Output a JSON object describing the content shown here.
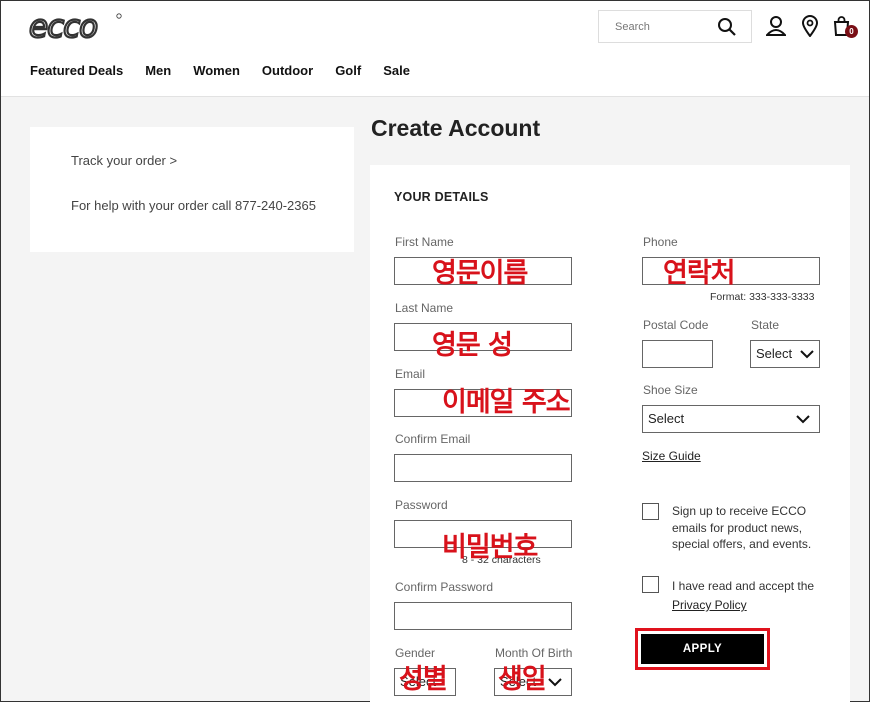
{
  "header": {
    "search_placeholder": "Search",
    "cart_count": "0",
    "nav": [
      "Featured Deals",
      "Men",
      "Women",
      "Outdoor",
      "Golf",
      "Sale"
    ]
  },
  "sidebar": {
    "track_order": "Track your order >",
    "help": "For help with your order call 877-240-2365"
  },
  "page": {
    "title": "Create Account",
    "section_title": "YOUR DETAILS"
  },
  "form": {
    "first_name": {
      "label": "First Name",
      "annotation": "영문이름"
    },
    "last_name": {
      "label": "Last Name",
      "annotation": "영문 성"
    },
    "email": {
      "label": "Email",
      "annotation": "이메일 주소"
    },
    "confirm_email": {
      "label": "Confirm Email"
    },
    "password": {
      "label": "Password",
      "hint": "8 - 32 characters",
      "annotation": "비밀번호"
    },
    "confirm_password": {
      "label": "Confirm Password"
    },
    "gender": {
      "label": "Gender",
      "value": "Select",
      "annotation": "성별"
    },
    "month_of_birth": {
      "label": "Month Of Birth",
      "value": "Select",
      "annotation": "생일"
    },
    "phone": {
      "label": "Phone",
      "format": "Format: 333-333-3333",
      "annotation": "연락처"
    },
    "postal_code": {
      "label": "Postal Code"
    },
    "state": {
      "label": "State",
      "value": "Select"
    },
    "shoe_size": {
      "label": "Shoe Size",
      "value": "Select"
    },
    "size_guide": "Size Guide",
    "newsletter": "Sign up to receive ECCO emails for product news, special offers, and events.",
    "terms_text": "I have read and accept the",
    "privacy_policy": "Privacy Policy",
    "apply": "APPLY"
  },
  "colors": {
    "accent_red": "#e0121d",
    "badge": "#7a0f16"
  }
}
